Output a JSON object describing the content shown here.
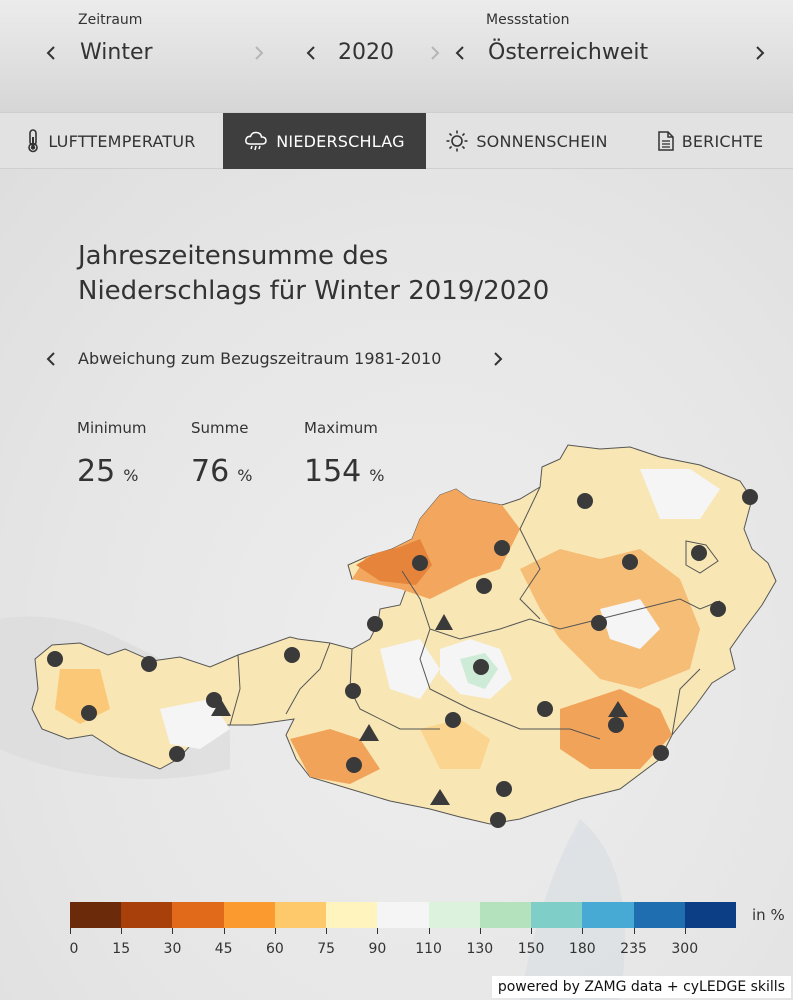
{
  "header": {
    "period_label": "Zeitraum",
    "period_value": "Winter",
    "year_value": "2020",
    "station_label": "Messstation",
    "station_value": "Österreichweit"
  },
  "tabs": [
    {
      "label": "LUFTTEMPERATUR",
      "icon": "thermometer-icon",
      "active": false
    },
    {
      "label": "NIEDERSCHLAG",
      "icon": "rain-cloud-icon",
      "active": true
    },
    {
      "label": "SONNENSCHEIN",
      "icon": "sun-icon",
      "active": false
    },
    {
      "label": "BERICHTE",
      "icon": "document-icon",
      "active": false
    }
  ],
  "main": {
    "title_line1": "Jahreszeitensumme des",
    "title_line2": "Niederschlags für Winter 2019/2020",
    "subtitle": "Abweichung zum Bezugszeitraum 1981-2010",
    "stats": [
      {
        "label": "Minimum",
        "value": "25",
        "unit": "%"
      },
      {
        "label": "Summe",
        "value": "76",
        "unit": "%"
      },
      {
        "label": "Maximum",
        "value": "154",
        "unit": "%"
      }
    ]
  },
  "legend": {
    "unit": "in %",
    "colors": [
      "#6b2a0a",
      "#a8400b",
      "#e06a1a",
      "#fb9a2e",
      "#fdc96b",
      "#fff4bd",
      "#f5f5f5",
      "#ddf2dc",
      "#b3e2bd",
      "#7fcfc8",
      "#46aad4",
      "#1f6eb0",
      "#0b3e84"
    ],
    "ticks": [
      "0",
      "15",
      "30",
      "45",
      "60",
      "75",
      "90",
      "110",
      "130",
      "150",
      "180",
      "235",
      "300"
    ]
  },
  "credit": "powered by ZAMG data + cyLEDGE skills"
}
